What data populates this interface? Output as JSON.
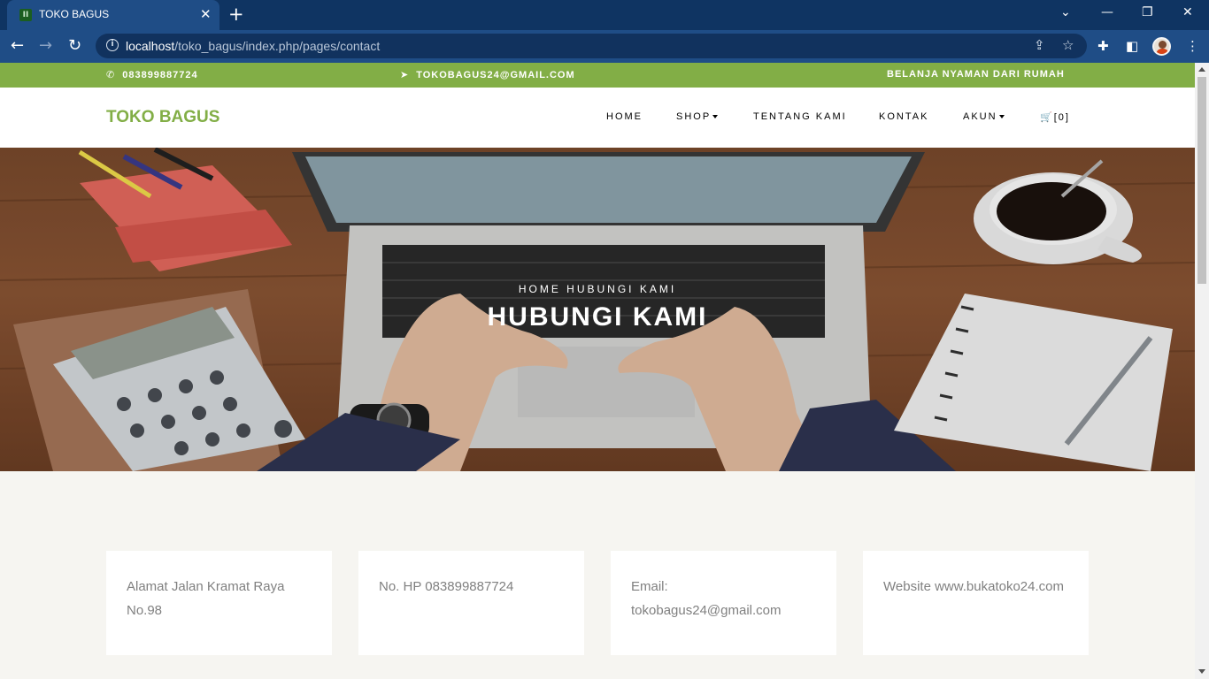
{
  "browser": {
    "tab_title": "TOKO BAGUS",
    "favicon_glyph": "II",
    "tab_close": "✕",
    "new_tab": "+",
    "url_host": "localhost",
    "url_path": "/toko_bagus/index.php/pages/contact",
    "icons": [
      "back-arrow-icon",
      "forward-arrow-icon",
      "reload-icon",
      "info-icon",
      "share-icon",
      "star-icon",
      "extensions-icon",
      "sidepanel-icon",
      "menu-icon"
    ]
  },
  "topbar": {
    "phone": "083899887724",
    "email": "TOKOBAGUS24@GMAIL.COM",
    "tagline": "BELANJA NYAMAN DARI RUMAH",
    "color": "#82ae46"
  },
  "navbar": {
    "brand": "TOKO BAGUS",
    "items": [
      {
        "label": "HOME"
      },
      {
        "label": "SHOP"
      },
      {
        "label": "TENTANG KAMI"
      },
      {
        "label": "KONTAK"
      },
      {
        "label": "AKUN"
      }
    ],
    "cart_count": "[0]"
  },
  "hero": {
    "breadcrumb": "HOME  HUBUNGI KAMI",
    "title": "HUBUNGI KAMI"
  },
  "contact_cards": [
    {
      "text": "Alamat Jalan Kramat Raya No.98"
    },
    {
      "text": "No. HP 083899887724"
    },
    {
      "text": "Email: tokobagus24@gmail.com"
    },
    {
      "text": "Website www.bukatoko24.com"
    }
  ]
}
